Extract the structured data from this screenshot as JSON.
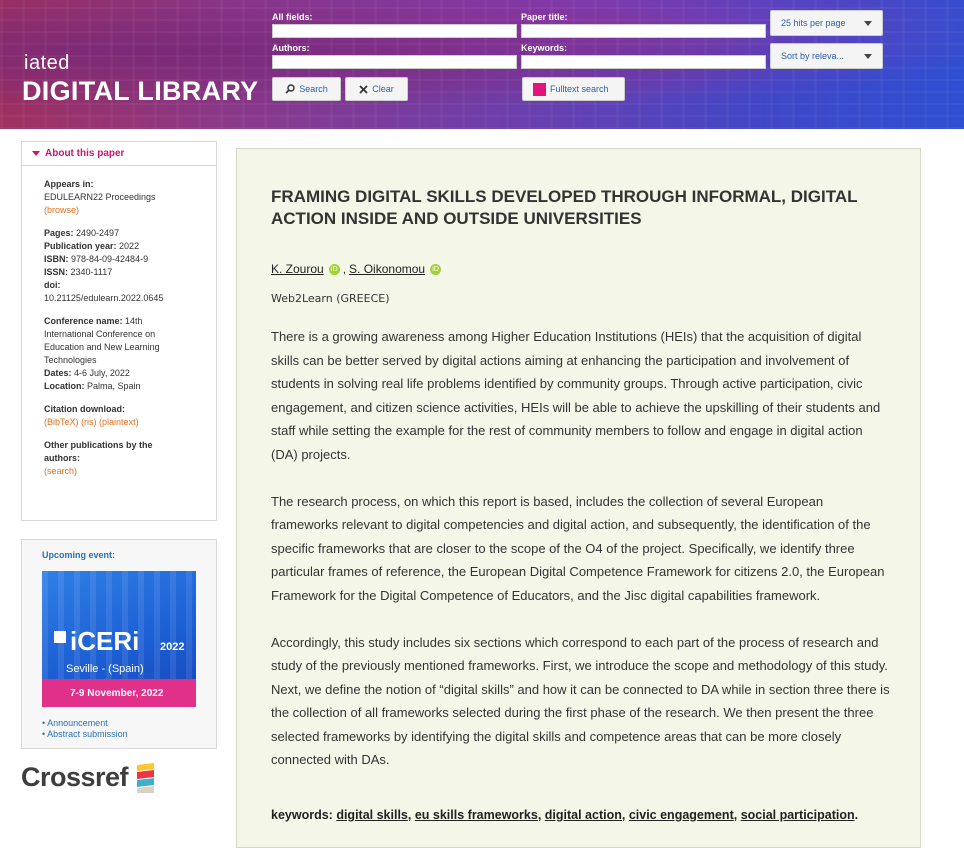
{
  "header": {
    "logo_small": "iated",
    "logo_big": "DIGITAL LIBRARY",
    "fields": {
      "all_fields_label": "All fields:",
      "paper_title_label": "Paper title:",
      "authors_label": "Authors:",
      "keywords_label": "Keywords:"
    },
    "buttons": {
      "search": "Search",
      "clear": "Clear",
      "fulltext": "Fulltext search"
    },
    "selects": {
      "hits": "25 hits per page",
      "sort": "Sort by releva..."
    }
  },
  "sidebar": {
    "about_title": "About this paper",
    "appears_in_label": "Appears in:",
    "appears_in_value": "EDULEARN22 Proceedings",
    "browse": "(browse)",
    "pages_label": "Pages:",
    "pages_value": "2490-2497",
    "pubyear_label": "Publication year:",
    "pubyear_value": "2022",
    "isbn_label": "ISBN:",
    "isbn_value": "978-84-09-42484-9",
    "issn_label": "ISSN:",
    "issn_value": "2340-1117",
    "doi_label": "doi:",
    "doi_value": "10.21125/edulearn.2022.0645",
    "conf_label": "Conference name:",
    "conf_value": "14th International Conference on Education and New Learning Technologies",
    "dates_label": "Dates:",
    "dates_value": "4-6 July, 2022",
    "location_label": "Location:",
    "location_value": "Palma, Spain",
    "citation_label": "Citation download:",
    "bibtex": "(BibTeX)",
    "ris": "(ris)",
    "plaintext": "(plaintext)",
    "other_pubs_label": "Other publications by the authors:",
    "search_link": "(search)"
  },
  "event": {
    "title": "Upcoming event:",
    "banner_name": "iCERi",
    "banner_year": "2022",
    "banner_city": "Seville - (Spain)",
    "banner_dates": "7-9 November, 2022",
    "link_announcement": "• Announcement",
    "link_abstract": "• Abstract submission"
  },
  "crossref": {
    "label": "Crossref"
  },
  "paper": {
    "title": "FRAMING DIGITAL SKILLS DEVELOPED THROUGH INFORMAL, DIGITAL ACTION INSIDE AND OUTSIDE UNIVERSITIES",
    "author1": "K. Zourou",
    "author2": "S. Oikonomou",
    "separator": ",",
    "affiliation": "Web2Learn (GREECE)",
    "abstract_p1": "There is a growing awareness among Higher Education Institutions (HEIs) that the acquisition of digital skills can be better served by digital actions aiming at enhancing the participation and involvement of students in solving real life problems identified by community groups. Through active participation, civic engagement, and citizen science activities, HEIs will be able to achieve the upskilling of their students and staff while setting the example for the rest of community members to follow and engage in digital action (DA) projects.",
    "abstract_p2": "The research process, on which this report is based, includes the collection of several European frameworks relevant to digital competencies and digital action, and subsequently, the identification of the specific frameworks that are closer to the scope of the O4 of the project. Specifically, we identify three particular frames of reference, the European Digital Competence Framework for citizens 2.0, the European Framework for the Digital Competence of Educators, and the Jisc digital capabilities framework.",
    "abstract_p3": "Accordingly, this study includes six sections which correspond to each part of the process of research and study of the previously mentioned frameworks. First, we introduce the scope and methodology of this study. Next, we define the notion of “digital skills” and how it can be connected to DA while in section three there is the collection of all frameworks selected during the first phase of the research. We then present the three selected frameworks by identifying the digital skills and competence areas that can be more closely connected with DAs.",
    "keywords_label": "keywords:",
    "keywords": [
      "digital skills",
      "eu skills frameworks",
      "digital action",
      "civic engagement",
      "social participation"
    ]
  },
  "colors": {
    "accent_pink": "#e2137d",
    "link_orange": "#e07020",
    "link_blue": "#2b6fb8",
    "paper_bg": "#f4f6e8"
  }
}
